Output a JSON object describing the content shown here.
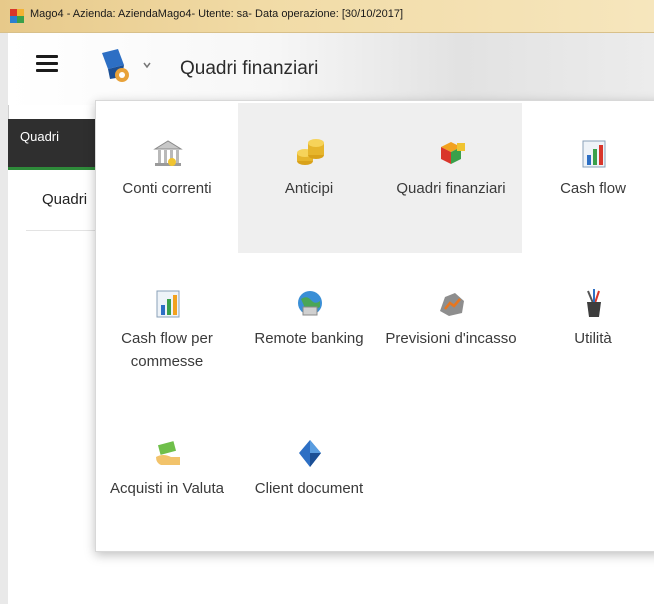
{
  "window": {
    "title": "Mago4 - Azienda: AziendaMago4- Utente: sa- Data operazione: [30/10/2017]"
  },
  "header": {
    "menu_icon": "hamburger-menu-icon",
    "module_icon": "module-logo-icon",
    "title": "Quadri finanziari"
  },
  "tabs": [
    {
      "label": "Quadri",
      "active": true
    }
  ],
  "page": {
    "heading": "Quadri"
  },
  "menu": {
    "items": [
      {
        "label": "Conti correnti",
        "icon": "bank-building-icon",
        "highlighted": false
      },
      {
        "label": "Anticipi",
        "icon": "gold-coins-icon",
        "highlighted": true
      },
      {
        "label": "Quadri finanziari",
        "icon": "colored-cubes-icon",
        "highlighted": true
      },
      {
        "label": "Cash flow",
        "icon": "bar-chart-icon",
        "highlighted": false
      },
      {
        "label": "Cash flow per commesse",
        "icon": "bar-chart-icon",
        "highlighted": false
      },
      {
        "label": "Remote banking",
        "icon": "globe-bank-icon",
        "highlighted": false
      },
      {
        "label": "Previsioni d'incasso",
        "icon": "forecast-rock-icon",
        "highlighted": false
      },
      {
        "label": "Utilità",
        "icon": "tools-cup-icon",
        "highlighted": false
      },
      {
        "label": "Acquisti in Valuta",
        "icon": "money-hand-icon",
        "highlighted": false
      },
      {
        "label": "Client document",
        "icon": "document-diamond-icon",
        "highlighted": false
      }
    ]
  },
  "colors": {
    "titlebar": "#f1dba6",
    "tabbar": "#2f2f2f",
    "tab_accent": "#2e8b3a",
    "tile_highlight": "#efefef"
  }
}
